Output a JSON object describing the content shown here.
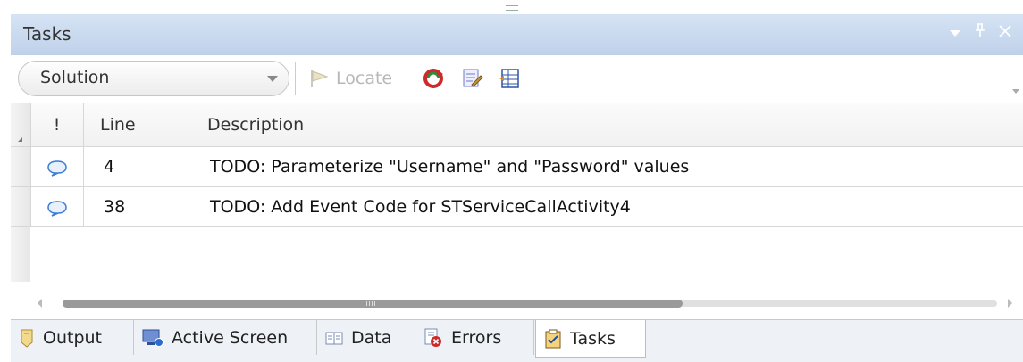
{
  "panel": {
    "title": "Tasks"
  },
  "toolbar": {
    "scope_selected": "Solution",
    "locate_label": "Locate",
    "icons": [
      "locate-icon",
      "refresh-icon",
      "edit-task-icon",
      "grid-options-icon"
    ]
  },
  "grid": {
    "columns": [
      "!",
      "Line",
      "Description"
    ],
    "rows": [
      {
        "priority_icon": "comment-icon",
        "line": "4",
        "description": "TODO: Parameterize \"Username\" and \"Password\" values"
      },
      {
        "priority_icon": "comment-icon",
        "line": "38",
        "description": "TODO: Add Event Code for STServiceCallActivity4"
      }
    ]
  },
  "tabs": [
    {
      "label": "Output",
      "icon": "output-icon",
      "active": false
    },
    {
      "label": "Active Screen",
      "icon": "active-screen-icon",
      "active": false
    },
    {
      "label": "Data",
      "icon": "data-icon",
      "active": false
    },
    {
      "label": "Errors",
      "icon": "errors-icon",
      "active": false
    },
    {
      "label": "Tasks",
      "icon": "tasks-icon",
      "active": true
    }
  ],
  "colors": {
    "titlebar": "#c8d8ee",
    "accent": "#cc2b2b"
  }
}
